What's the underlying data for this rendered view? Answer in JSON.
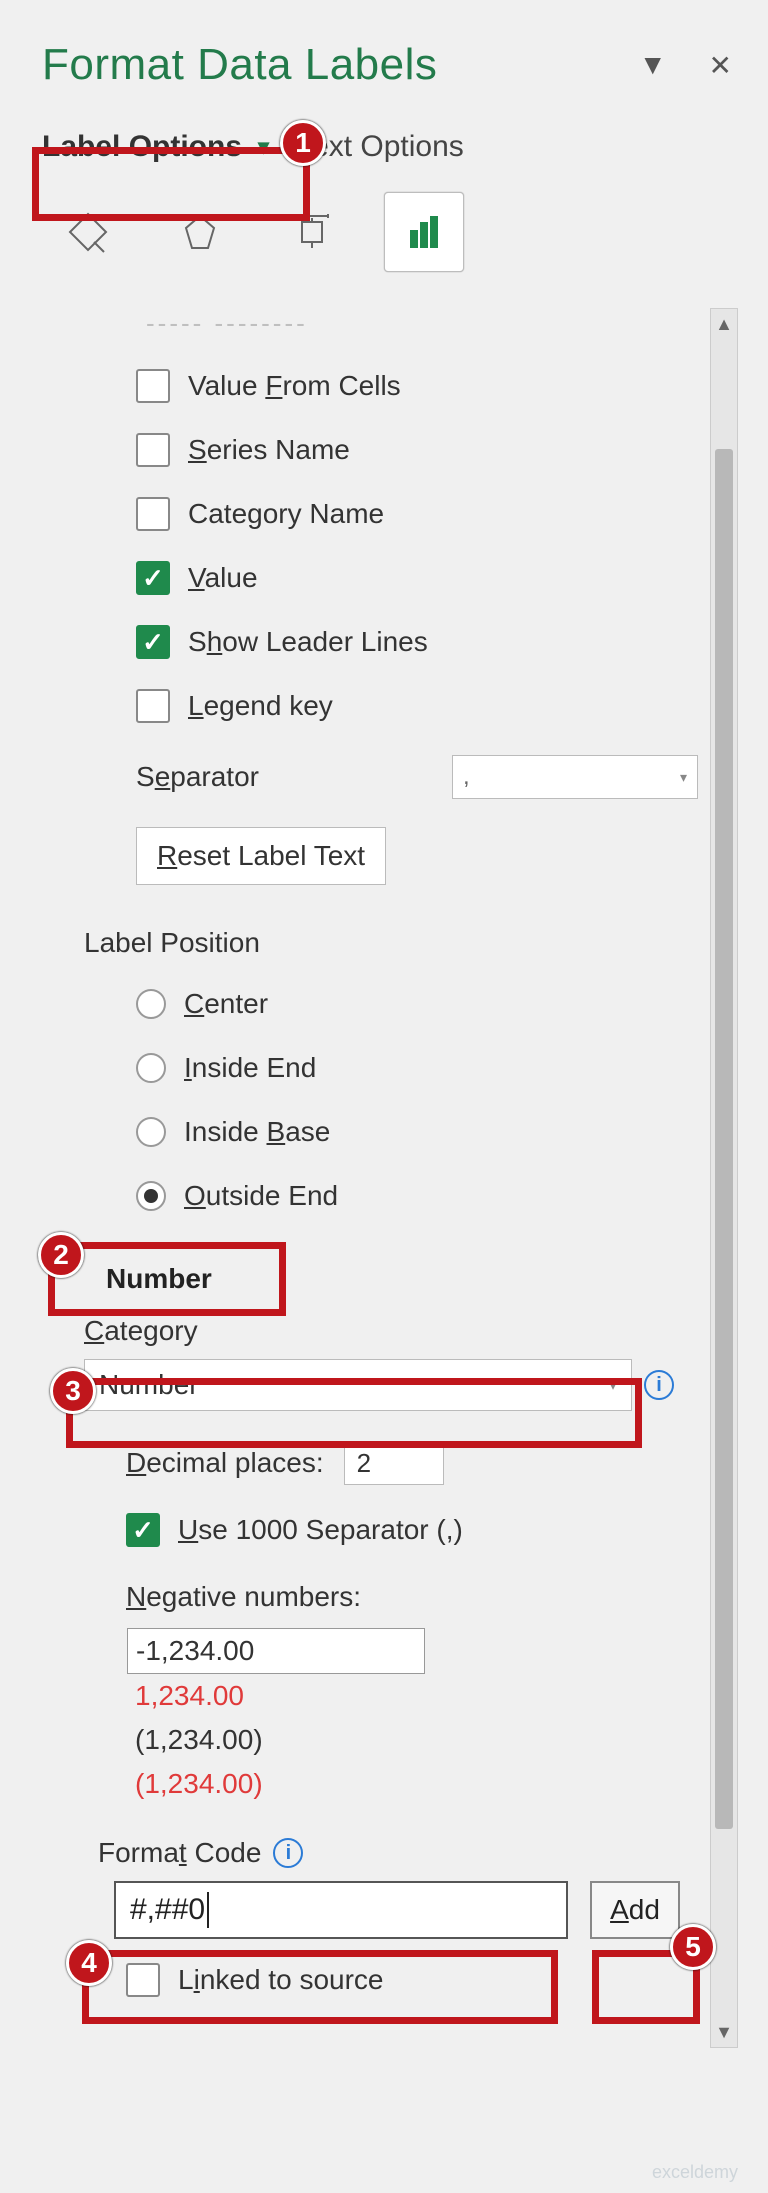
{
  "header": {
    "title": "Format Data Labels"
  },
  "tabs": {
    "label_options": "Label Options",
    "text_options": "Text Options"
  },
  "label_contains": {
    "section_cut": "----- --------",
    "value_from_cells": "Value From Cells",
    "series_name": "Series Name",
    "category_name": "Category Name",
    "value": "Value",
    "leader_lines": "Show Leader Lines",
    "legend_key": "Legend key"
  },
  "separator": {
    "label": "Separator",
    "value": ","
  },
  "reset_label": "Reset Label Text",
  "label_position": {
    "title": "Label Position",
    "center": "Center",
    "inside_end": "Inside End",
    "inside_base": "Inside Base",
    "outside_end": "Outside End"
  },
  "number": {
    "section": "Number",
    "category_label": "Category",
    "category_value": "Number",
    "decimal_label": "Decimal places:",
    "decimal_value": "2",
    "use_sep": "Use 1000 Separator (,)",
    "negative_label": "Negative numbers:",
    "neg_items": [
      "-1,234.00",
      "1,234.00",
      "(1,234.00)",
      "(1,234.00)"
    ],
    "format_code_label": "Format Code",
    "format_code_value": "#,##0",
    "add_label": "Add",
    "linked": "Linked to source"
  },
  "watermark": "exceldemy"
}
